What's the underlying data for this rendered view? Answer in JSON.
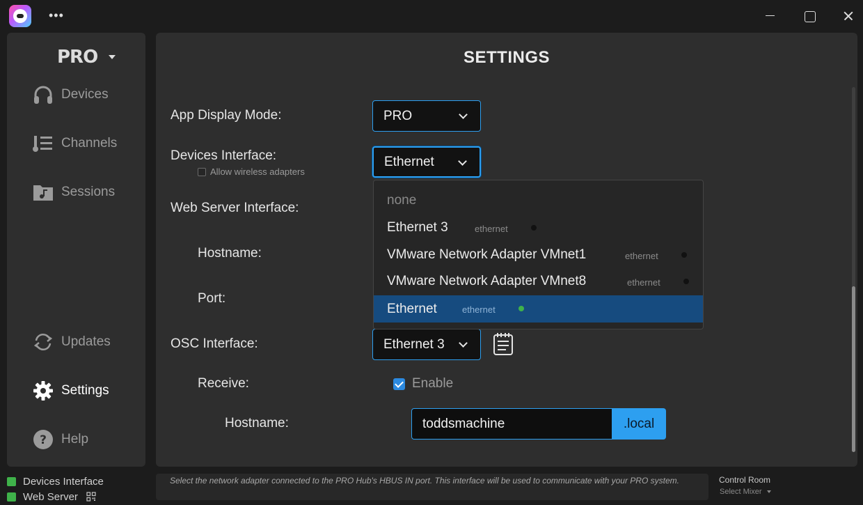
{
  "sidebar": {
    "mode_label": "PRO",
    "items": [
      {
        "label": "Devices",
        "icon": "headphones-icon"
      },
      {
        "label": "Channels",
        "icon": "channels-icon"
      },
      {
        "label": "Sessions",
        "icon": "folder-music-icon"
      },
      {
        "label": "Updates",
        "icon": "refresh-icon"
      },
      {
        "label": "Settings",
        "icon": "gear-icon",
        "active": true
      },
      {
        "label": "Help",
        "icon": "help-icon"
      }
    ]
  },
  "settings": {
    "title": "SETTINGS",
    "app_display_mode_label": "App Display Mode:",
    "app_display_mode_value": "PRO",
    "devices_interface_label": "Devices Interface:",
    "devices_interface_value": "Ethernet",
    "allow_wireless_label": "Allow wireless adapters",
    "web_server_interface_label": "Web Server Interface:",
    "hostname_label": "Hostname:",
    "port_label": "Port:",
    "osc_interface_label": "OSC Interface:",
    "osc_interface_value": "Ethernet 3",
    "receive_label": "Receive:",
    "enable_label": "Enable",
    "receive_hostname_label": "Hostname:",
    "receive_hostname_value": "toddsmachine",
    "hostname_suffix": ".local"
  },
  "dropdown": {
    "options": [
      {
        "name": "none",
        "type": "",
        "status": ""
      },
      {
        "name": "Ethernet 3",
        "type": "ethernet",
        "status": "inactive"
      },
      {
        "name": "VMware Network Adapter VMnet1",
        "type": "ethernet",
        "status": "inactive"
      },
      {
        "name": "VMware Network Adapter VMnet8",
        "type": "ethernet",
        "status": "inactive"
      },
      {
        "name": "Ethernet",
        "type": "ethernet",
        "status": "active",
        "selected": true
      }
    ]
  },
  "status": {
    "devices_interface": "Devices Interface",
    "web_server": "Web Server",
    "indicator_color": "#3fb24a",
    "hint": "Select the network adapter connected to the PRO Hub's HBUS IN port. This interface will be used to communicate with your PRO system.",
    "control_room": "Control Room",
    "select_mixer": "Select Mixer"
  },
  "colors": {
    "accent": "#2d9ff0",
    "selected_row": "#164b7f",
    "active_dot": "#3fb24a"
  }
}
